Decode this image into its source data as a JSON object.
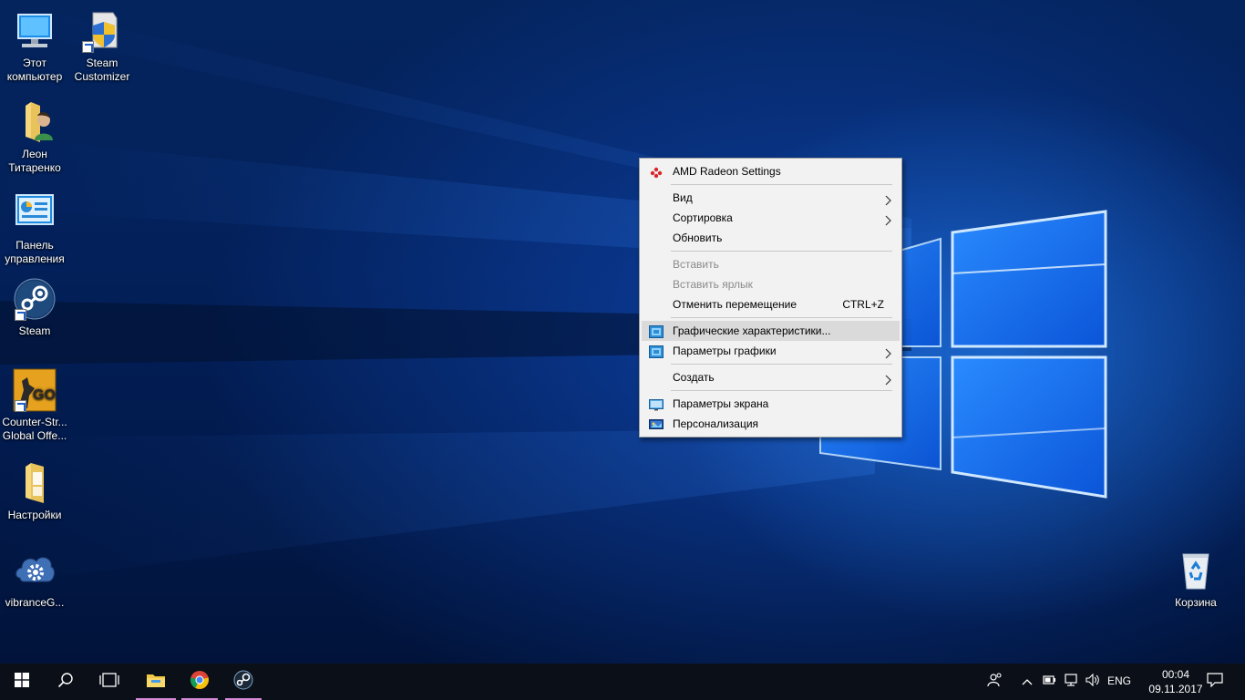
{
  "desktop": {
    "icons": [
      {
        "label": "Этот\nкомпьютер",
        "icon": "this-pc-icon"
      },
      {
        "label": "Steam\nCustomizer",
        "icon": "steam-customizer-icon"
      },
      {
        "label": "Леон\nТитаренко",
        "icon": "user-folder-icon"
      },
      {
        "label": "Панель\nуправления",
        "icon": "control-panel-icon"
      },
      {
        "label": "Steam",
        "icon": "steam-icon"
      },
      {
        "label": "Counter-Str...\nGlobal Offe...",
        "icon": "csgo-icon"
      },
      {
        "label": "Настройки",
        "icon": "settings-folder-icon"
      },
      {
        "label": "vibranceG...",
        "icon": "vibrancegui-icon"
      },
      {
        "label": "Корзина",
        "icon": "recycle-bin-icon"
      }
    ]
  },
  "context_menu": {
    "items": [
      {
        "label": "AMD Radeon Settings",
        "icon": "amd-radeon-icon"
      },
      {
        "label": "Вид",
        "submenu": true
      },
      {
        "label": "Сортировка",
        "submenu": true
      },
      {
        "label": "Обновить"
      },
      {
        "label": "Вставить",
        "disabled": true
      },
      {
        "label": "Вставить ярлык",
        "disabled": true
      },
      {
        "label": "Отменить перемещение",
        "shortcut": "CTRL+Z"
      },
      {
        "label": "Графические характеристики...",
        "icon": "intel-graphics-icon",
        "highlighted": true
      },
      {
        "label": "Параметры графики",
        "icon": "intel-graphics-icon",
        "submenu": true
      },
      {
        "label": "Создать",
        "submenu": true
      },
      {
        "label": "Параметры экрана",
        "icon": "display-settings-icon"
      },
      {
        "label": "Персонализация",
        "icon": "personalization-icon"
      }
    ]
  },
  "taskbar": {
    "pinned": [
      "start-icon",
      "search-icon",
      "task-view-icon",
      "file-explorer-icon",
      "chrome-icon",
      "steam-icon"
    ],
    "tray": {
      "language": "ENG",
      "time": "00:04",
      "date": "09.11.2017"
    }
  },
  "colors": {
    "taskbar": "#0b0f17",
    "menu_bg": "#f2f2f2",
    "menu_hover": "#dadada",
    "active_indicator": "#d58ad7"
  }
}
